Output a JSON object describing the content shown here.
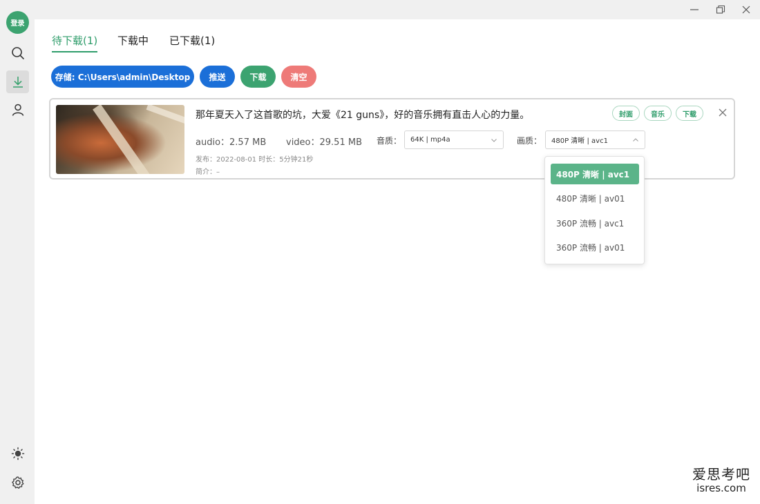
{
  "sidebar": {
    "login_label": "登录",
    "icons": [
      "search-icon",
      "download-icon",
      "user-icon",
      "sun-icon",
      "gear-icon"
    ],
    "active_color": "#3ca370"
  },
  "tabs": [
    {
      "label": "待下载(1)",
      "active": true
    },
    {
      "label": "下载中",
      "active": false
    },
    {
      "label": "已下载(1)",
      "active": false
    }
  ],
  "toolbar": {
    "storage_label": "存储: C:\\Users\\admin\\Desktop",
    "push_label": "推送",
    "download_label": "下载",
    "clear_label": "清空"
  },
  "item": {
    "title": "那年夏天入了这首歌的坑，大爱《21 guns》，好的音乐拥有直击人心的力量。",
    "audio_size": "audio：2.57 MB",
    "video_size": "video：29.51 MB",
    "audio_quality_label": "音质：",
    "audio_quality_value": "64K | mp4a",
    "video_quality_label": "画质：",
    "video_quality_value": "480P 清晰 | avc1",
    "meta_line": "发布：2022-08-01 时长：5分钟21秒",
    "intro_line": "简介：–",
    "tags": [
      "封面",
      "音乐",
      "下载"
    ]
  },
  "video_quality_options": [
    {
      "label": "480P 清晰 | avc1",
      "selected": true
    },
    {
      "label": "480P 清晰 | av01",
      "selected": false
    },
    {
      "label": "360P 流畅 | avc1",
      "selected": false
    },
    {
      "label": "360P 流畅 | av01",
      "selected": false
    }
  ],
  "watermark": {
    "line1": "爱思考吧",
    "line2": "isres.com"
  }
}
